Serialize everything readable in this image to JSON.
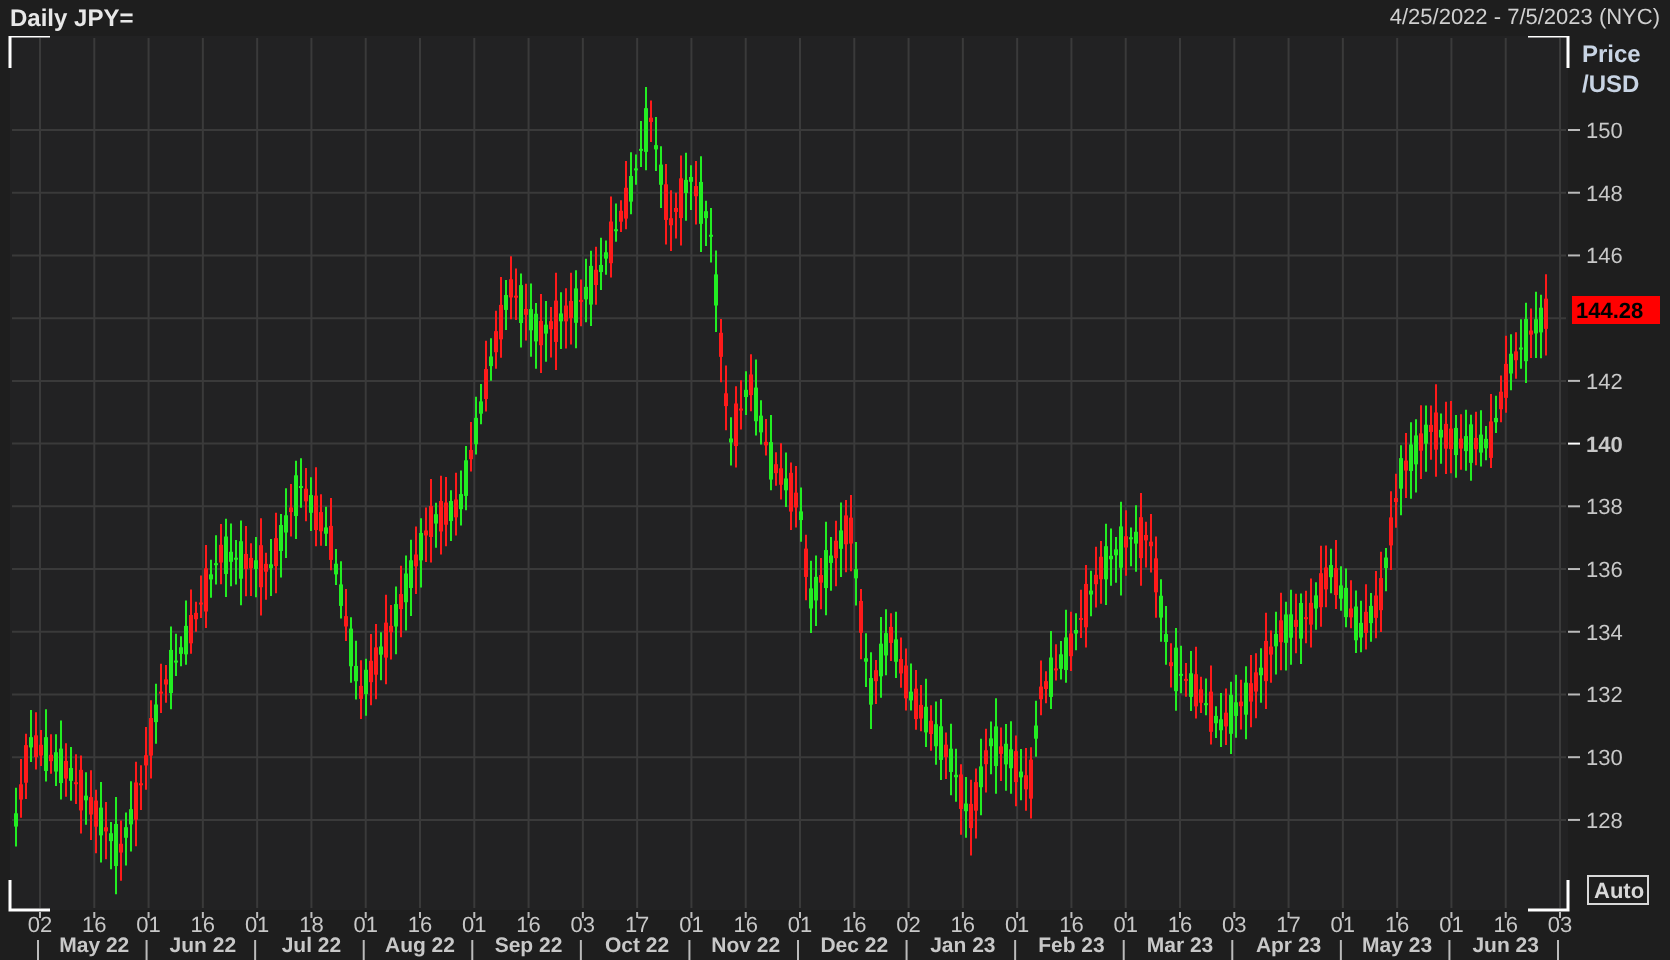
{
  "header": {
    "title": "Daily JPY=",
    "range": "4/25/2022 - 7/5/2023 (NYC)"
  },
  "price_axis": {
    "title_lines": [
      "Price",
      "/USD"
    ],
    "ticks_above_last": [
      {
        "label": "150",
        "major": false
      },
      {
        "label": "148",
        "major": false
      },
      {
        "label": "146",
        "major": false
      }
    ],
    "ticks_below_last": [
      {
        "label": "142",
        "major": false
      },
      {
        "label": "140",
        "major": true
      },
      {
        "label": "138",
        "major": false
      },
      {
        "label": "136",
        "major": false
      },
      {
        "label": "134",
        "major": false
      },
      {
        "label": "132",
        "major": false
      },
      {
        "label": "130",
        "major": false
      },
      {
        "label": "128",
        "major": false
      }
    ],
    "last_price": "144.28",
    "auto_button": "Auto"
  },
  "time_axis": {
    "months": [
      {
        "label": "May 22",
        "days": [
          "02",
          "16"
        ]
      },
      {
        "label": "Jun 22",
        "days": [
          "01",
          "16"
        ]
      },
      {
        "label": "Jul 22",
        "days": [
          "01",
          "18"
        ]
      },
      {
        "label": "Aug 22",
        "days": [
          "01",
          "16"
        ]
      },
      {
        "label": "Sep 22",
        "days": [
          "01",
          "16"
        ]
      },
      {
        "label": "Oct 22",
        "days": [
          "03",
          "17"
        ]
      },
      {
        "label": "Nov 22",
        "days": [
          "01",
          "16"
        ]
      },
      {
        "label": "Dec 22",
        "days": [
          "01",
          "16"
        ]
      },
      {
        "label": "Jan 23",
        "days": [
          "02",
          "16"
        ]
      },
      {
        "label": "Feb 23",
        "days": [
          "01",
          "16"
        ]
      },
      {
        "label": "Mar 23",
        "days": [
          "01",
          "16"
        ]
      },
      {
        "label": "Apr 23",
        "days": [
          "03",
          "17"
        ]
      },
      {
        "label": "May 23",
        "days": [
          "01",
          "16"
        ]
      },
      {
        "label": "Jun 23",
        "days": [
          "01",
          "16"
        ]
      },
      {
        "days": [
          "03"
        ]
      }
    ]
  }
}
